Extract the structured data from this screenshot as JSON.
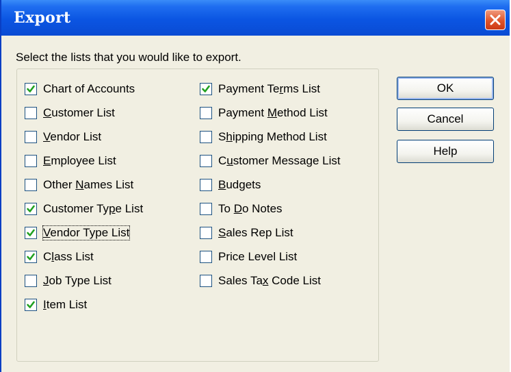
{
  "window": {
    "title": "Export"
  },
  "prompt": "Select the lists that you would like to export.",
  "left_items": [
    {
      "text": "Chart of Accounts",
      "checked": true
    },
    {
      "text": "Customer List",
      "checked": false,
      "underline": 0
    },
    {
      "text": "Vendor List",
      "checked": false,
      "underline": 0
    },
    {
      "text": "Employee List",
      "checked": false,
      "underline": 0
    },
    {
      "text": "Other Names List",
      "checked": false,
      "underline": 6
    },
    {
      "text": "Customer Type List",
      "checked": true,
      "underline": 11
    },
    {
      "text": "Vendor Type List",
      "checked": true,
      "underline": 0,
      "focused": true
    },
    {
      "text": "Class List",
      "checked": true,
      "underline": 1
    },
    {
      "text": "Job Type List",
      "checked": false,
      "underline": 0
    },
    {
      "text": "Item List",
      "checked": true,
      "underline": 0
    }
  ],
  "right_items": [
    {
      "text": "Payment Terms List",
      "checked": true,
      "underline": 10
    },
    {
      "text": "Payment Method List",
      "checked": false,
      "underline": 8
    },
    {
      "text": "Shipping Method List",
      "checked": false,
      "underline": 1
    },
    {
      "text": "Customer Message List",
      "checked": false,
      "underline": 1
    },
    {
      "text": "Budgets",
      "checked": false,
      "underline": 0
    },
    {
      "text": "To Do Notes",
      "checked": false,
      "underline": 3
    },
    {
      "text": "Sales Rep List",
      "checked": false,
      "underline": 0
    },
    {
      "text": "Price Level List",
      "checked": false
    },
    {
      "text": "Sales Tax Code List",
      "checked": false,
      "underline": 8
    }
  ],
  "buttons": {
    "ok": "OK",
    "cancel": "Cancel",
    "help": "Help"
  },
  "colors": {
    "titlebar": "#0a4bd3",
    "dialog_bg": "#f1efe2",
    "check": "#21a121",
    "close": "#e0542a"
  },
  "icons": {
    "close": "close-icon",
    "check": "checkmark-icon"
  }
}
